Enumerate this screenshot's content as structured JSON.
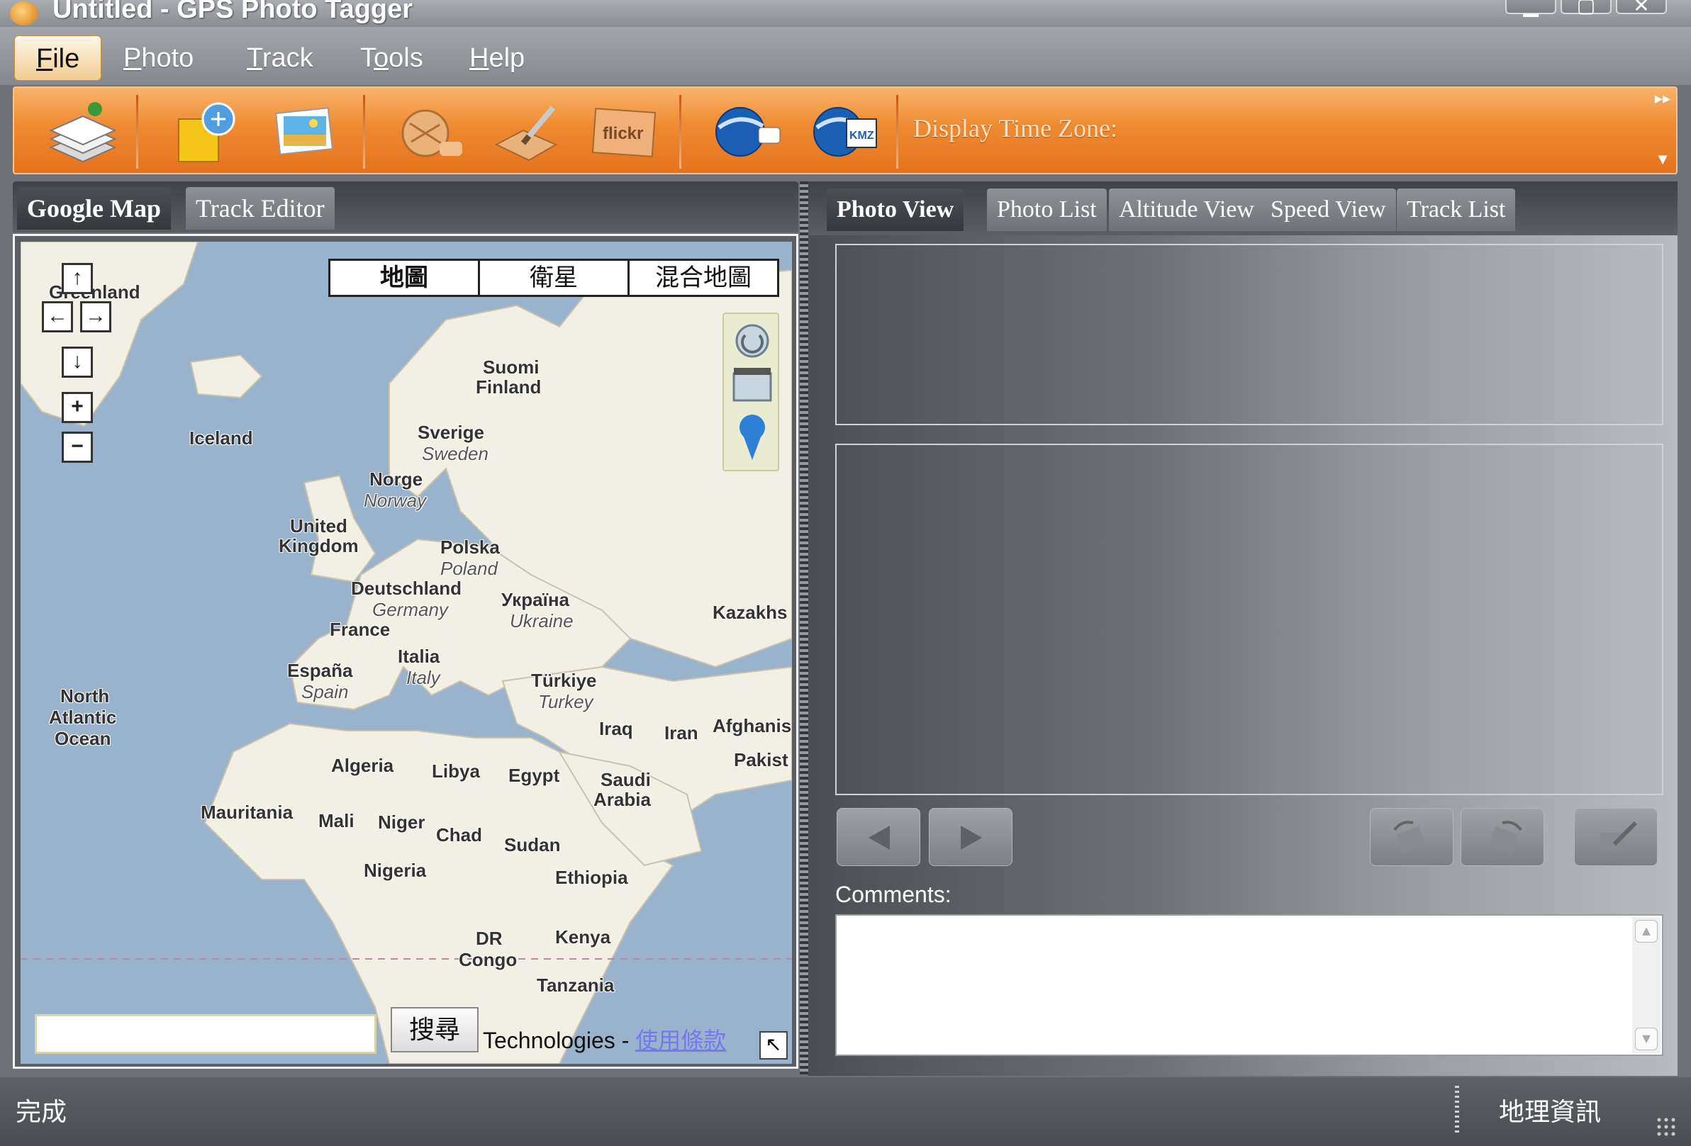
{
  "window": {
    "title": "Untitled - GPS Photo Tagger",
    "controls": [
      "▁",
      "▢",
      "✕"
    ]
  },
  "menu": {
    "items": [
      {
        "label": "File",
        "accel": "F",
        "rest": "ile"
      },
      {
        "label": "Photo",
        "accel": "P",
        "rest": "hoto"
      },
      {
        "label": "Track",
        "accel": "T",
        "rest": "rack"
      },
      {
        "label": "Tools",
        "accel": "o",
        "pre": "T",
        "rest": "ols"
      },
      {
        "label": "Help",
        "accel": "H",
        "rest": "elp"
      }
    ]
  },
  "toolbar": {
    "time_zone_label": "Display Time Zone:",
    "buttons": [
      "load-layers-icon",
      "export-folder-icon",
      "photos-icon",
      "geotag-disc-icon",
      "write-pen-icon",
      "flickr-icon",
      "google-earth-icon",
      "kmz-export-icon"
    ],
    "flickr_text": "flickr",
    "kmz_text": "KMZ"
  },
  "left_tabs": [
    "Google Map",
    "Track Editor"
  ],
  "map": {
    "types": [
      "地圖",
      "衛星",
      "混合地圖"
    ],
    "search_button": "搜尋",
    "search_value": "",
    "footer_text": "Technologies - ",
    "footer_link": "使用條款",
    "labels": [
      {
        "text": "Greenland",
        "italic": false
      },
      {
        "text": "Iceland",
        "italic": false
      },
      {
        "text": "Suomi",
        "italic": false
      },
      {
        "text": "Finland",
        "italic": false
      },
      {
        "text": "Sverige",
        "italic": false
      },
      {
        "text": "Sweden",
        "italic": true
      },
      {
        "text": "Norge",
        "italic": false
      },
      {
        "text": "Norway",
        "italic": true
      },
      {
        "text": "United",
        "italic": false
      },
      {
        "text": "Kingdom",
        "italic": false
      },
      {
        "text": "Polska",
        "italic": false
      },
      {
        "text": "Poland",
        "italic": true
      },
      {
        "text": "Deutschland",
        "italic": false
      },
      {
        "text": "Germany",
        "italic": true
      },
      {
        "text": "Україна",
        "italic": false
      },
      {
        "text": "Ukraine",
        "italic": true
      },
      {
        "text": "France",
        "italic": false
      },
      {
        "text": "Kazakhs",
        "italic": false
      },
      {
        "text": "Italia",
        "italic": false
      },
      {
        "text": "Italy",
        "italic": true
      },
      {
        "text": "España",
        "italic": false
      },
      {
        "text": "Spain",
        "italic": true
      },
      {
        "text": "Türkiye",
        "italic": false
      },
      {
        "text": "Turkey",
        "italic": true
      },
      {
        "text": "North",
        "italic": false
      },
      {
        "text": "Atlantic",
        "italic": false
      },
      {
        "text": "Ocean",
        "italic": false
      },
      {
        "text": "Iraq",
        "italic": false
      },
      {
        "text": "Iran",
        "italic": false
      },
      {
        "text": "Afghanis",
        "italic": false
      },
      {
        "text": "Pakist",
        "italic": false
      },
      {
        "text": "Algeria",
        "italic": false
      },
      {
        "text": "Libya",
        "italic": false
      },
      {
        "text": "Egypt",
        "italic": false
      },
      {
        "text": "Saudi",
        "italic": false
      },
      {
        "text": "Arabia",
        "italic": false
      },
      {
        "text": "Mauritania",
        "italic": false
      },
      {
        "text": "Mali",
        "italic": false
      },
      {
        "text": "Niger",
        "italic": false
      },
      {
        "text": "Chad",
        "italic": false
      },
      {
        "text": "Sudan",
        "italic": false
      },
      {
        "text": "Nigeria",
        "italic": false
      },
      {
        "text": "Ethiopia",
        "italic": false
      },
      {
        "text": "DR",
        "italic": false
      },
      {
        "text": "Congo",
        "italic": false
      },
      {
        "text": "Kenya",
        "italic": false
      },
      {
        "text": "Tanzania",
        "italic": false
      }
    ]
  },
  "right_tabs": [
    "Photo View",
    "Photo List",
    "Altitude View",
    "Speed View",
    "Track List"
  ],
  "photo_view": {
    "comments_label": "Comments:",
    "comments_value": ""
  },
  "status": {
    "left": "完成",
    "right": "地理資訊"
  },
  "colors": {
    "toolbar_orange": "#ef8a32",
    "map_water": "#99b3cc",
    "map_land": "#f2efe4",
    "chrome_gray": "#6e7177"
  }
}
